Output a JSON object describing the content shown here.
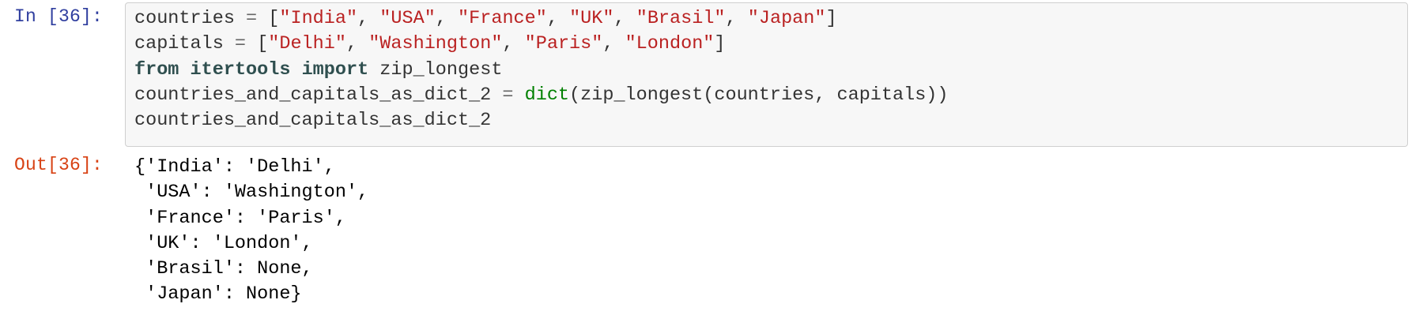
{
  "input_cell": {
    "prompt": "In [36]:",
    "lines": [
      [
        {
          "t": "name",
          "v": "countries "
        },
        {
          "t": "op",
          "v": "="
        },
        {
          "t": "punc",
          "v": " ["
        },
        {
          "t": "str",
          "v": "\"India\""
        },
        {
          "t": "punc",
          "v": ", "
        },
        {
          "t": "str",
          "v": "\"USA\""
        },
        {
          "t": "punc",
          "v": ", "
        },
        {
          "t": "str",
          "v": "\"France\""
        },
        {
          "t": "punc",
          "v": ", "
        },
        {
          "t": "str",
          "v": "\"UK\""
        },
        {
          "t": "punc",
          "v": ", "
        },
        {
          "t": "str",
          "v": "\"Brasil\""
        },
        {
          "t": "punc",
          "v": ", "
        },
        {
          "t": "str",
          "v": "\"Japan\""
        },
        {
          "t": "punc",
          "v": "]"
        }
      ],
      [
        {
          "t": "name",
          "v": "capitals "
        },
        {
          "t": "op",
          "v": "="
        },
        {
          "t": "punc",
          "v": " ["
        },
        {
          "t": "str",
          "v": "\"Delhi\""
        },
        {
          "t": "punc",
          "v": ", "
        },
        {
          "t": "str",
          "v": "\"Washington\""
        },
        {
          "t": "punc",
          "v": ", "
        },
        {
          "t": "str",
          "v": "\"Paris\""
        },
        {
          "t": "punc",
          "v": ", "
        },
        {
          "t": "str",
          "v": "\"London\""
        },
        {
          "t": "punc",
          "v": "]"
        }
      ],
      [
        {
          "t": "kwimp",
          "v": "from"
        },
        {
          "t": "punc",
          "v": " "
        },
        {
          "t": "kwimp",
          "v": "itertools"
        },
        {
          "t": "punc",
          "v": " "
        },
        {
          "t": "kwimp",
          "v": "import"
        },
        {
          "t": "name",
          "v": " zip_longest"
        }
      ],
      [
        {
          "t": "name",
          "v": "countries_and_capitals_as_dict_2 "
        },
        {
          "t": "op",
          "v": "="
        },
        {
          "t": "punc",
          "v": " "
        },
        {
          "t": "builtin",
          "v": "dict"
        },
        {
          "t": "name",
          "v": "(zip_longest(countries, capitals))"
        }
      ],
      [
        {
          "t": "name",
          "v": "countries_and_capitals_as_dict_2"
        }
      ]
    ]
  },
  "output_cell": {
    "prompt": "Out[36]:",
    "lines": [
      "{'India': 'Delhi',",
      " 'USA': 'Washington',",
      " 'France': 'Paris',",
      " 'UK': 'London',",
      " 'Brasil': None,",
      " 'Japan': None}"
    ]
  },
  "colors": {
    "in_prompt": "#303F9F",
    "out_prompt": "#D84315",
    "string": "#BA2121",
    "keyword": "#2F4F4F",
    "builtin": "#008000",
    "input_background": "#f7f7f7",
    "input_border": "#cfcfcf"
  }
}
